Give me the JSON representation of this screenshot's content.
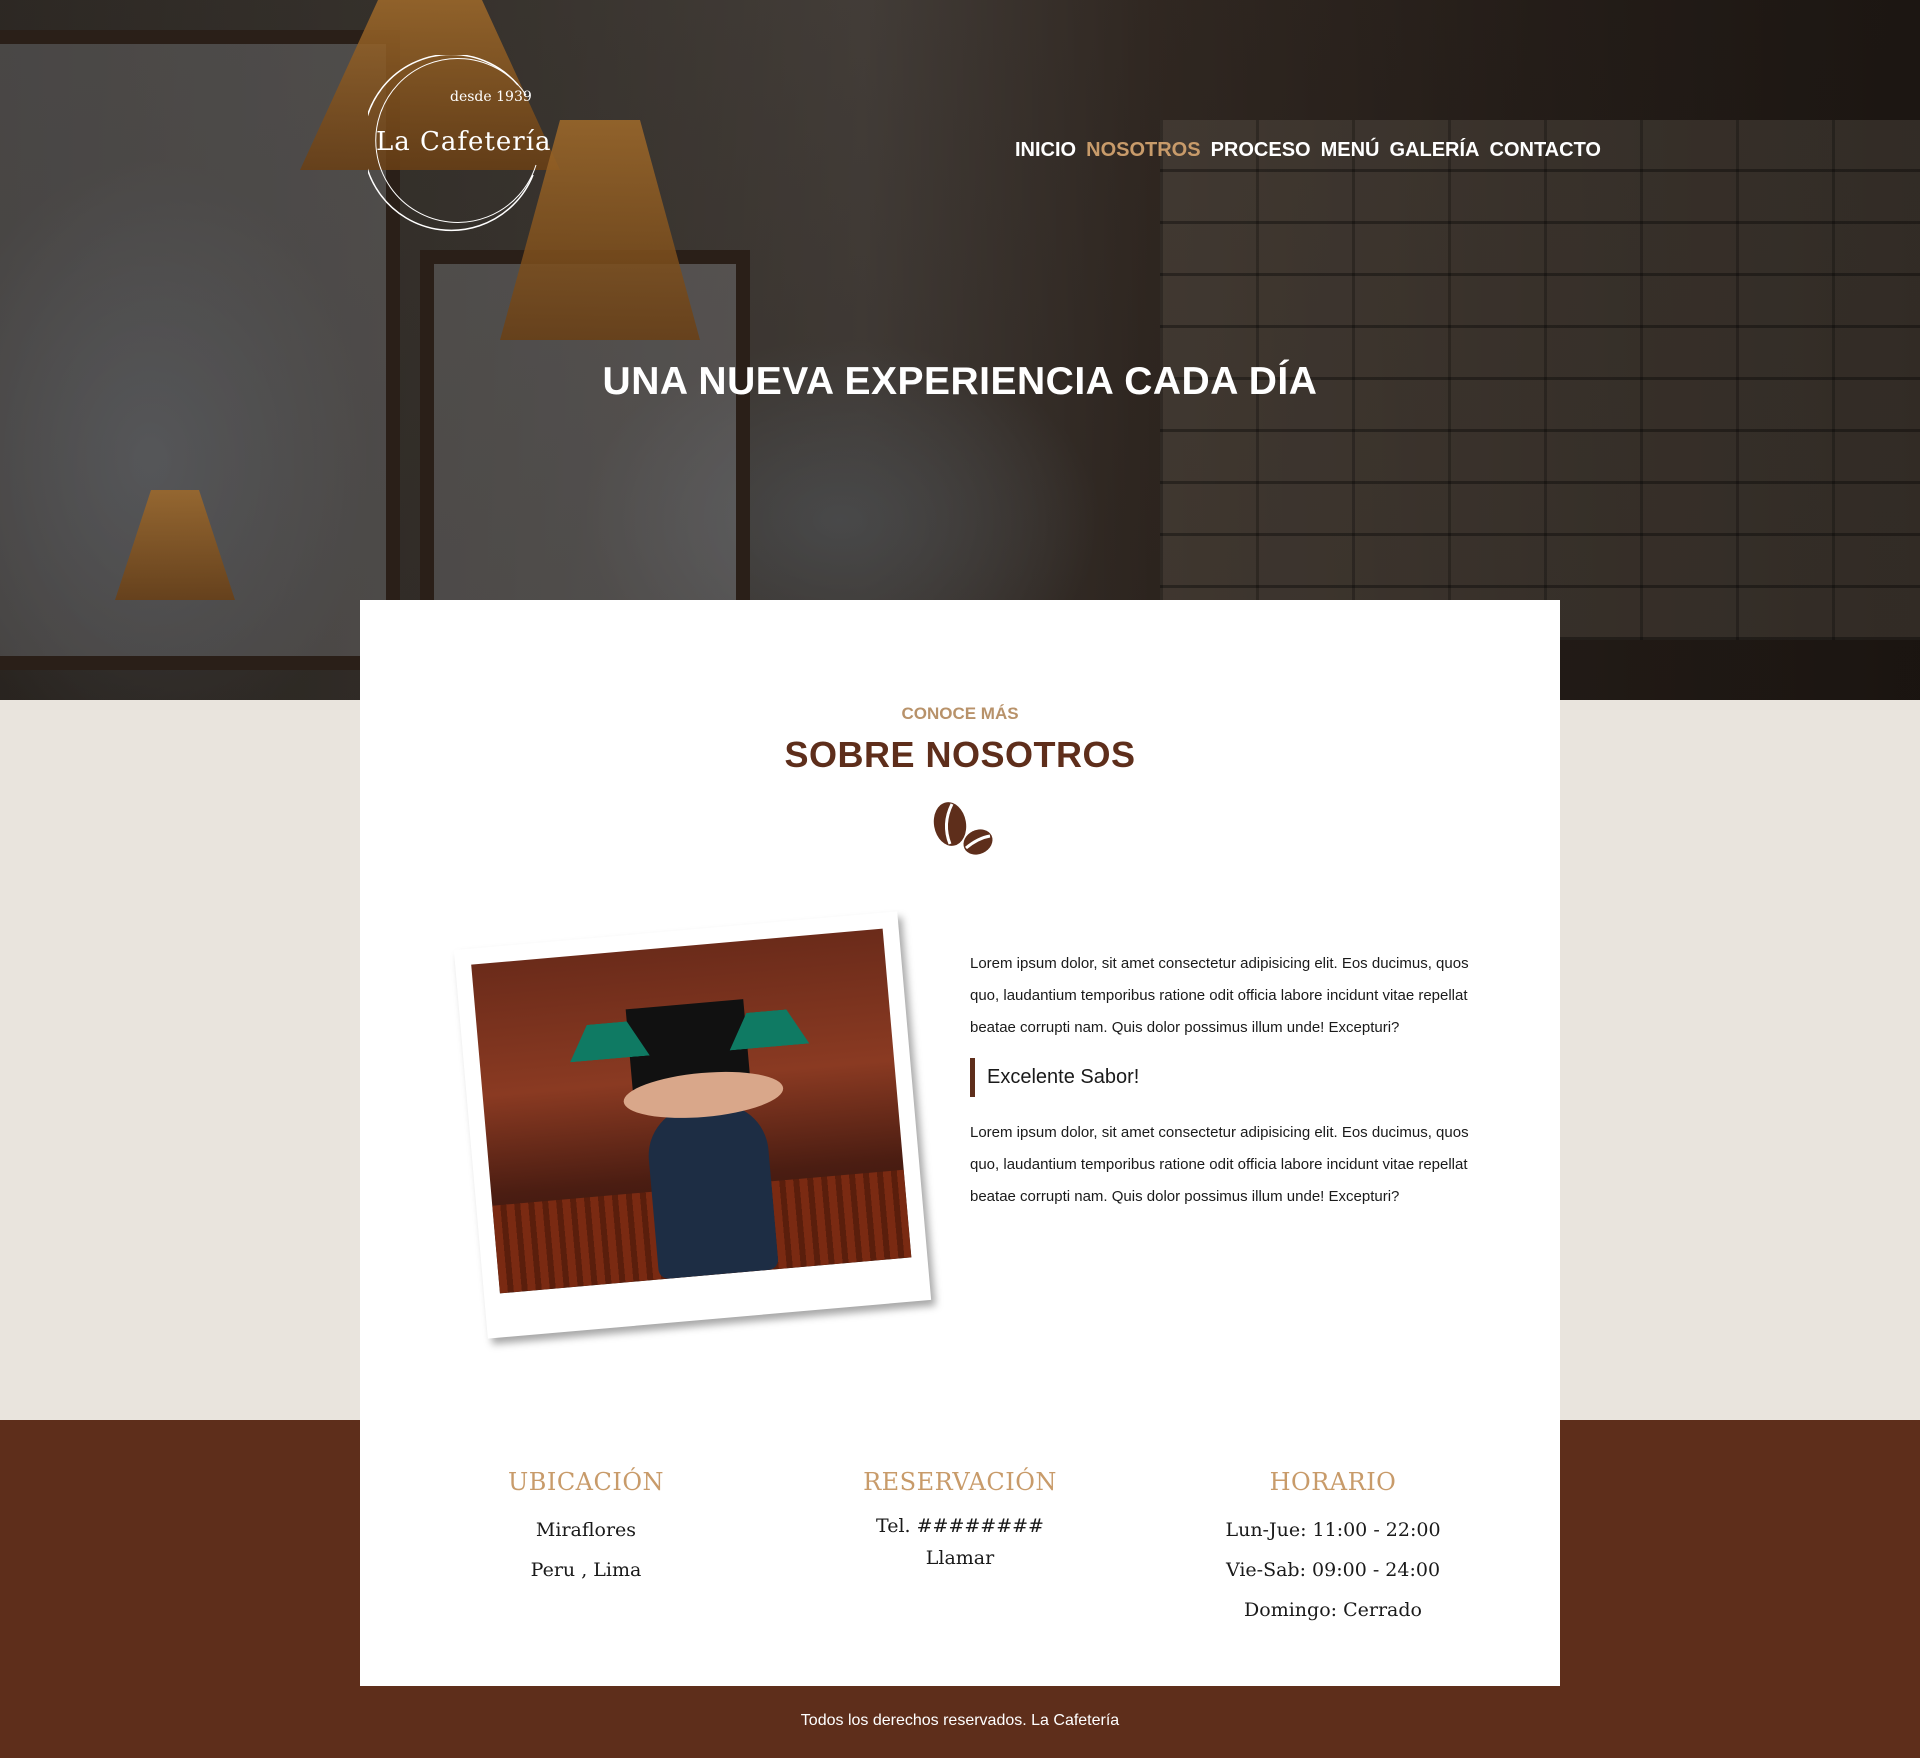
{
  "brand": {
    "since": "desde 1939",
    "name": "La Cafetería"
  },
  "nav": {
    "items": [
      {
        "label": "INICIO"
      },
      {
        "label": "NOSOTROS"
      },
      {
        "label": "PROCESO"
      },
      {
        "label": "MENÚ"
      },
      {
        "label": "GALERÍA"
      },
      {
        "label": "CONTACTO"
      }
    ],
    "active": "NOSOTROS"
  },
  "hero": {
    "title": "UNA NUEVA EXPERIENCIA CADA DÍA"
  },
  "about": {
    "kicker": "CONOCE MÁS",
    "title": "SOBRE NOSOTROS",
    "icon": "coffee-beans-icon",
    "paragraph1": "Lorem ipsum dolor, sit amet consectetur adipisicing elit. Eos ducimus, quos quo, laudantium temporibus ratione odit officia labore incidunt vitae repellat beatae corrupti nam. Quis dolor possimus illum unde! Excepturi?",
    "quote": "Excelente Sabor!",
    "paragraph2": "Lorem ipsum dolor, sit amet consectetur adipisicing elit. Eos ducimus, quos quo, laudantium temporibus ratione odit officia labore incidunt vitae repellat beatae corrupti nam. Quis dolor possimus illum unde! Excepturi?"
  },
  "info": {
    "location": {
      "title": "UBICACIÓN",
      "line1": "Miraflores",
      "line2": "Peru , Lima"
    },
    "reservation": {
      "title": "RESERVACIÓN",
      "phone": "Tel. ########",
      "call": "Llamar"
    },
    "schedule": {
      "title": "HORARIO",
      "line1": "Lun-Jue: 11:00 - 22:00",
      "line2": "Vie-Sab: 09:00 - 24:00",
      "line3": "Domingo: Cerrado"
    }
  },
  "footer": {
    "copyright": "Todos los derechos reservados. La Cafetería"
  },
  "colors": {
    "accent": "#c89b6a",
    "brown": "#5e2e1b",
    "beige": "#e9e4dd"
  }
}
